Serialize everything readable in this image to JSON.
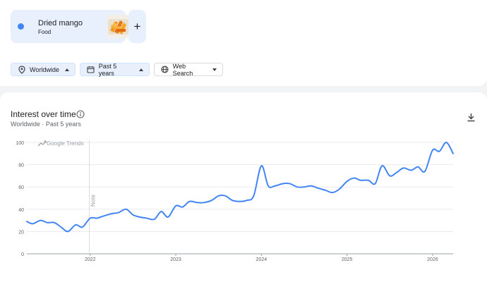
{
  "term": {
    "name": "Dried mango",
    "category": "Food",
    "color": "#4285f4",
    "image_icon": "dried-mango-thumbnail"
  },
  "add_button": {
    "label": "+"
  },
  "filters": {
    "region": {
      "label": "Worldwide",
      "icon": "location-pin-icon"
    },
    "time": {
      "label": "Past 5 years",
      "icon": "calendar-icon"
    },
    "property": {
      "label": "Web Search",
      "icon": "globe-icon"
    }
  },
  "card": {
    "title": "Interest over time",
    "subtitle": "Worldwide · Past 5 years",
    "info_icon": "info-icon",
    "download_icon": "download-icon"
  },
  "chart_data": {
    "type": "line",
    "watermark": "Google Trends",
    "note_label": "Note",
    "note_x": 2021.99,
    "y_ticks": [
      0,
      20,
      40,
      60,
      80,
      100
    ],
    "ylim": [
      0,
      100
    ],
    "xlim": [
      2021.26,
      2026.24
    ],
    "x_ticks": [
      {
        "label": "2022",
        "x": 2022.0
      },
      {
        "label": "2023",
        "x": 2023.0
      },
      {
        "label": "2024",
        "x": 2024.0
      },
      {
        "label": "2025",
        "x": 2025.0
      },
      {
        "label": "2026",
        "x": 2026.0
      }
    ],
    "grid": true,
    "series": [
      {
        "name": "Dried mango",
        "color": "#4285f4",
        "points": [
          [
            2021.26,
            29
          ],
          [
            2021.33,
            27
          ],
          [
            2021.42,
            30
          ],
          [
            2021.5,
            28
          ],
          [
            2021.58,
            28
          ],
          [
            2021.66,
            24
          ],
          [
            2021.74,
            20
          ],
          [
            2021.83,
            26
          ],
          [
            2021.91,
            24
          ],
          [
            2022.0,
            32
          ],
          [
            2022.08,
            32
          ],
          [
            2022.16,
            34
          ],
          [
            2022.25,
            36
          ],
          [
            2022.33,
            37
          ],
          [
            2022.42,
            40
          ],
          [
            2022.5,
            35
          ],
          [
            2022.58,
            33
          ],
          [
            2022.66,
            32
          ],
          [
            2022.75,
            31
          ],
          [
            2022.83,
            38
          ],
          [
            2022.91,
            33
          ],
          [
            2023.0,
            43
          ],
          [
            2023.08,
            42
          ],
          [
            2023.16,
            47
          ],
          [
            2023.25,
            46
          ],
          [
            2023.33,
            46
          ],
          [
            2023.42,
            48
          ],
          [
            2023.5,
            52
          ],
          [
            2023.58,
            52
          ],
          [
            2023.66,
            48
          ],
          [
            2023.75,
            47
          ],
          [
            2023.83,
            48
          ],
          [
            2023.91,
            52
          ],
          [
            2024.0,
            79
          ],
          [
            2024.08,
            61
          ],
          [
            2024.16,
            61
          ],
          [
            2024.25,
            63
          ],
          [
            2024.33,
            63
          ],
          [
            2024.42,
            60
          ],
          [
            2024.5,
            60
          ],
          [
            2024.58,
            61
          ],
          [
            2024.66,
            59
          ],
          [
            2024.75,
            57
          ],
          [
            2024.83,
            55
          ],
          [
            2024.91,
            58
          ],
          [
            2025.0,
            65
          ],
          [
            2025.08,
            68
          ],
          [
            2025.16,
            66
          ],
          [
            2025.25,
            66
          ],
          [
            2025.33,
            63
          ],
          [
            2025.41,
            79
          ],
          [
            2025.5,
            70
          ],
          [
            2025.58,
            73
          ],
          [
            2025.66,
            77
          ],
          [
            2025.75,
            75
          ],
          [
            2025.83,
            78
          ],
          [
            2025.91,
            74
          ],
          [
            2026.0,
            93
          ],
          [
            2026.08,
            92
          ],
          [
            2026.16,
            100
          ],
          [
            2026.24,
            90
          ]
        ]
      }
    ]
  }
}
